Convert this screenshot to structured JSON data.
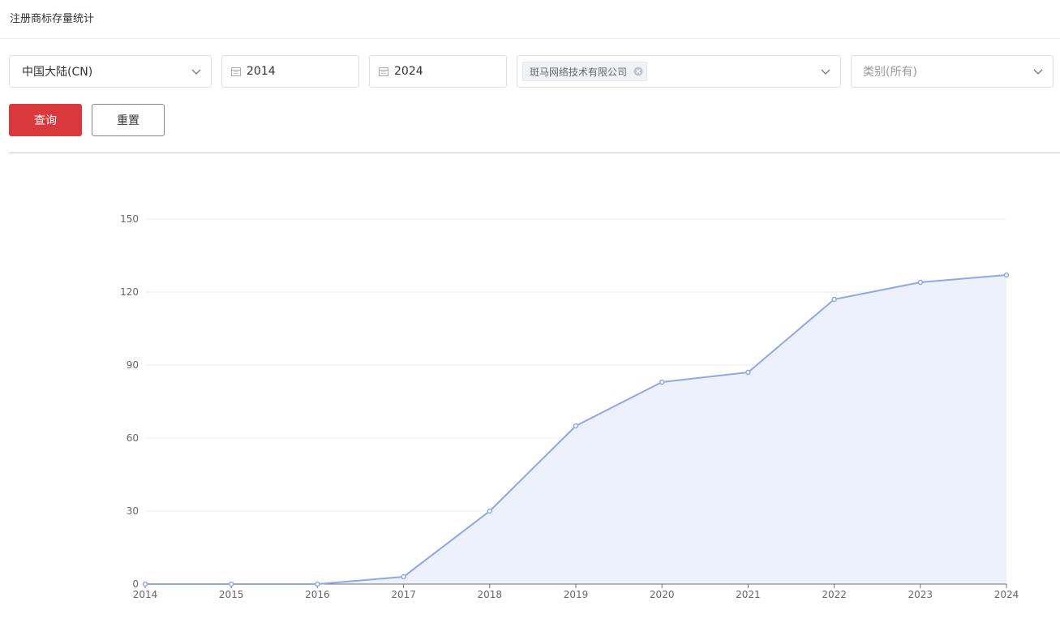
{
  "page": {
    "title": "注册商标存量统计"
  },
  "filters": {
    "region": {
      "value": "中国大陆(CN)"
    },
    "start_year": {
      "value": "2014"
    },
    "end_year": {
      "value": "2024"
    },
    "company": {
      "tags": [
        "斑马网络技术有限公司"
      ]
    },
    "category": {
      "placeholder": "类别(所有)"
    }
  },
  "buttons": {
    "query": "查询",
    "reset": "重置"
  },
  "colors": {
    "primary": "#d9393d",
    "line": "#8fa8e8",
    "area": "#edf1fc",
    "grid": "#eeeeee"
  },
  "icons": {
    "dropdown": "chevron-down-icon",
    "date": "calendar-icon",
    "tag_remove": "close-circle-icon"
  },
  "chart_data": {
    "type": "area",
    "x": [
      "2014",
      "2015",
      "2016",
      "2017",
      "2018",
      "2019",
      "2020",
      "2021",
      "2022",
      "2023",
      "2024"
    ],
    "series": [
      {
        "values": [
          0,
          0,
          0,
          3,
          30,
          65,
          83,
          87,
          117,
          124,
          127
        ]
      }
    ],
    "yticks": [
      0,
      30,
      60,
      90,
      120,
      150
    ],
    "ylim": [
      0,
      150
    ],
    "grid": true,
    "legend": "none"
  }
}
